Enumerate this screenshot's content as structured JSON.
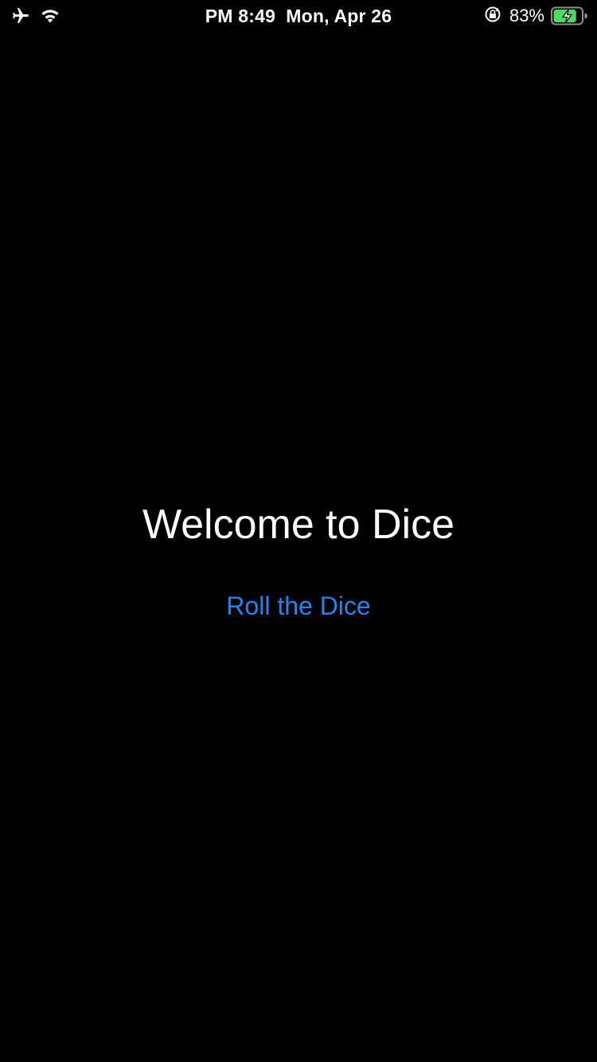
{
  "status_bar": {
    "time": "PM 8:49",
    "date": "Mon, Apr 26",
    "battery_percent": "83%",
    "battery_level": 0.83,
    "icons": [
      "airplane-icon",
      "wifi-icon",
      "orientation-lock-icon",
      "battery-charging-icon"
    ]
  },
  "main": {
    "title": "Welcome to Dice",
    "roll_button_label": "Roll the Dice"
  },
  "colors": {
    "background": "#000000",
    "text": "#ffffff",
    "accent": "#1e86f0",
    "battery_fill": "#4cd964"
  }
}
